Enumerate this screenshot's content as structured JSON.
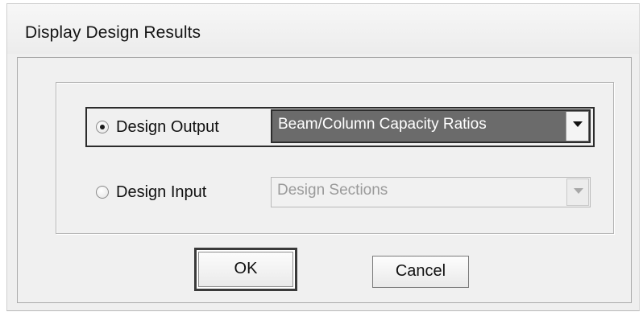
{
  "window": {
    "title": "Display Design Results"
  },
  "options": {
    "design_output": {
      "label": "Design Output",
      "selected": true,
      "dropdown_value": "Beam/Column Capacity Ratios",
      "enabled": true
    },
    "design_input": {
      "label": "Design Input",
      "selected": false,
      "dropdown_value": "Design Sections",
      "enabled": false
    }
  },
  "buttons": {
    "ok_label": "OK",
    "cancel_label": "Cancel"
  },
  "icons": {
    "dropdown": "chevron-down-icon",
    "radio_selected": "radio-selected-icon",
    "radio_unselected": "radio-unselected-icon"
  }
}
